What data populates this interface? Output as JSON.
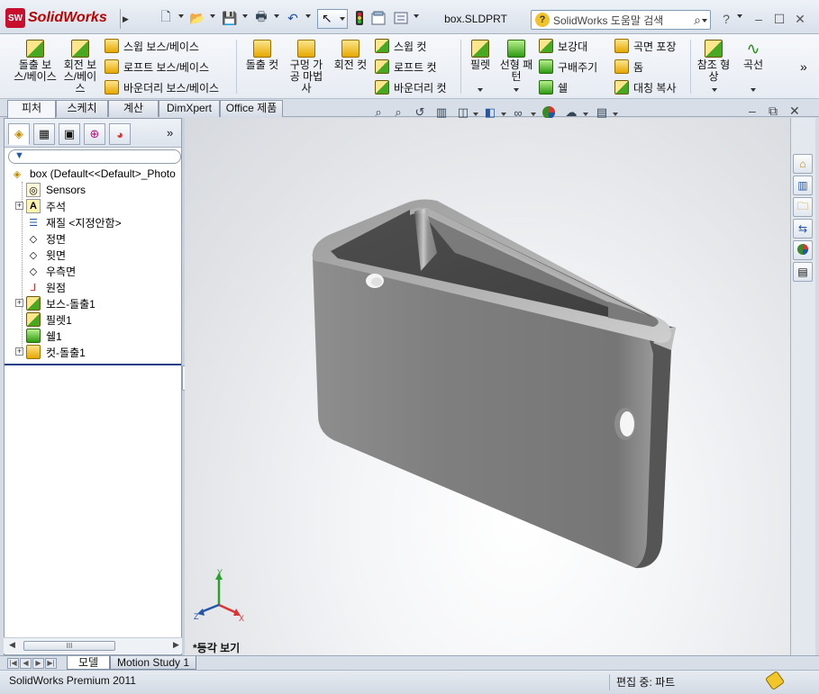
{
  "app": {
    "logo_text": "SolidWorks",
    "logo_badge": "SW",
    "document_title": "box.SLDPRT",
    "search_placeholder": "SolidWorks 도움말 검색"
  },
  "ribbon": {
    "large_buttons": [
      {
        "label": "돌출 보스/베이스",
        "icon": "extruded-boss-icon"
      },
      {
        "label": "회전 보스/베이스",
        "icon": "revolved-boss-icon"
      },
      {
        "label": "돌출 컷",
        "icon": "extruded-cut-icon"
      },
      {
        "label": "구멍 가공 마법사",
        "icon": "hole-wizard-icon"
      },
      {
        "label": "회전 컷",
        "icon": "revolved-cut-icon"
      },
      {
        "label": "필렛",
        "icon": "fillet-icon"
      },
      {
        "label": "선형 패턴",
        "icon": "linear-pattern-icon"
      },
      {
        "label": "참조 형상",
        "icon": "reference-geometry-icon"
      },
      {
        "label": "곡선",
        "icon": "curves-icon"
      }
    ],
    "small_buttons": [
      {
        "label": "스윕 보스/베이스",
        "icon": "swept-boss-icon"
      },
      {
        "label": "로프트 보스/베이스",
        "icon": "lofted-boss-icon"
      },
      {
        "label": "바운더리 보스/베이스",
        "icon": "boundary-boss-icon"
      },
      {
        "label": "스윕 컷",
        "icon": "swept-cut-icon"
      },
      {
        "label": "로프트 컷",
        "icon": "lofted-cut-icon"
      },
      {
        "label": "바운더리 컷",
        "icon": "boundary-cut-icon"
      },
      {
        "label": "보강대",
        "icon": "rib-icon"
      },
      {
        "label": "구배주기",
        "icon": "draft-icon"
      },
      {
        "label": "쉘",
        "icon": "shell-icon"
      },
      {
        "label": "곡면 포장",
        "icon": "wrap-icon"
      },
      {
        "label": "돔",
        "icon": "dome-icon"
      },
      {
        "label": "대칭 복사",
        "icon": "mirror-icon"
      }
    ],
    "overflow": "»"
  },
  "command_tabs": [
    "피처",
    "스케치",
    "계산",
    "DimXpert",
    "Office 제품"
  ],
  "active_command_tab": "피처",
  "feature_manager": {
    "tab_overflow": "»",
    "tree": [
      {
        "label": "box  (Default<<Default>_Photo",
        "icon": "part-icon",
        "expandable": false
      },
      {
        "label": "Sensors",
        "icon": "sensors-icon",
        "expandable": false
      },
      {
        "label": "주석",
        "icon": "annotations-icon",
        "expandable": true
      },
      {
        "label": "재질 <지정안함>",
        "icon": "material-icon",
        "expandable": false
      },
      {
        "label": "정면",
        "icon": "plane-icon",
        "expandable": false
      },
      {
        "label": "윗면",
        "icon": "plane-icon",
        "expandable": false
      },
      {
        "label": "우측면",
        "icon": "plane-icon",
        "expandable": false
      },
      {
        "label": "원점",
        "icon": "origin-icon",
        "expandable": false
      },
      {
        "label": "보스-돌출1",
        "icon": "boss-extrude-icon",
        "expandable": true
      },
      {
        "label": "필렛1",
        "icon": "fillet-icon",
        "expandable": false
      },
      {
        "label": "쉘1",
        "icon": "shell-icon",
        "expandable": false
      },
      {
        "label": "컷-돌출1",
        "icon": "cut-extrude-icon",
        "expandable": true
      }
    ],
    "scroll_thumb_label": "III"
  },
  "viewport": {
    "view_name": "*등각 보기",
    "triad": {
      "x": "X",
      "y": "Y",
      "z": "Z"
    }
  },
  "bottom_tabs": [
    "모델",
    "Motion Study 1"
  ],
  "active_bottom_tab": "모델",
  "status": {
    "product": "SolidWorks Premium 2011",
    "mode": "편집 중: 파트"
  },
  "colors": {
    "brand_red": "#c8102e",
    "model_gray": "#7a7a7a",
    "accent_blue": "#2456a8"
  }
}
